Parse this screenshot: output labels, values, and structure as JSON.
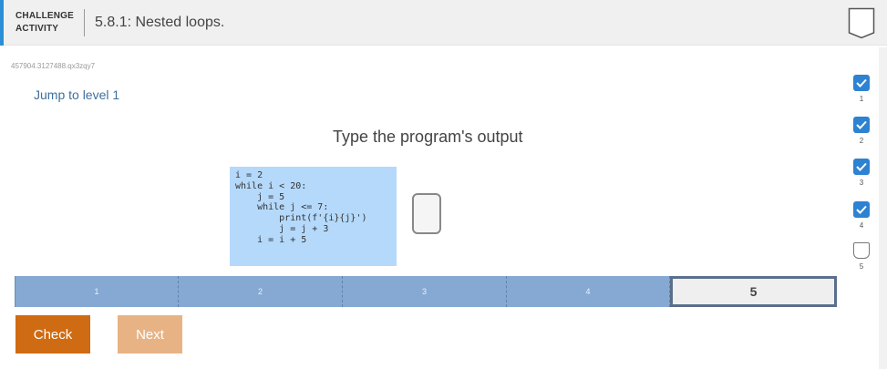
{
  "header": {
    "label_line1": "CHALLENGE",
    "label_line2": "ACTIVITY",
    "title": "5.8.1: Nested loops."
  },
  "activity_id": "457904.3127488.qx3zqy7",
  "jump_link": "Jump to level 1",
  "prompt": "Type the program's output",
  "code": [
    "i = 2",
    "while i < 20:",
    "    j = 5",
    "    while j <= 7:",
    "        print(f'{i}{j}')",
    "        j = j + 3",
    "    i = i + 5"
  ],
  "answer_value": "",
  "levels": [
    {
      "label": "1",
      "current": false
    },
    {
      "label": "2",
      "current": false
    },
    {
      "label": "3",
      "current": false
    },
    {
      "label": "4",
      "current": false
    },
    {
      "label": "5",
      "current": true
    }
  ],
  "buttons": {
    "check": "Check",
    "next": "Next"
  },
  "progress_indicators": [
    {
      "num": "1",
      "status": "done"
    },
    {
      "num": "2",
      "status": "done"
    },
    {
      "num": "3",
      "status": "done"
    },
    {
      "num": "4",
      "status": "done"
    },
    {
      "num": "5",
      "status": "todo"
    }
  ],
  "colors": {
    "accent": "#2a8fd6",
    "check_button": "#cf6b12",
    "next_button": "#e8b384",
    "code_bg": "#b5d9fb",
    "level_bar": "#85a9d3",
    "done_indicator": "#2d82d1"
  }
}
